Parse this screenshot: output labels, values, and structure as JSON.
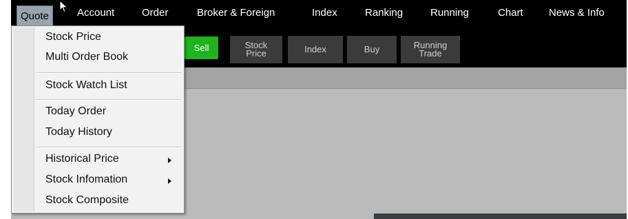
{
  "menubar": {
    "items": [
      "Quote",
      "Account",
      "Order",
      "Broker & Foreign",
      "Index",
      "Ranking",
      "Running",
      "Chart",
      "News & Info"
    ]
  },
  "toolbar": {
    "buttons": [
      {
        "label": "Sell",
        "color": "#1fb31f"
      },
      {
        "label": "Stock Price"
      },
      {
        "label": "Index"
      },
      {
        "label": "Buy"
      },
      {
        "label": "Running Trade"
      }
    ]
  },
  "quote_menu": {
    "items": [
      "Stock Price",
      "Multi Order Book",
      "Stock Watch List",
      "Today Order",
      "Today History",
      "Historical Price",
      "Stock Infomation",
      "Stock Composite"
    ],
    "submenu_indicator_icon": "triangle-right-icon"
  },
  "colors": {
    "sell_button": "#1fb31f",
    "menubar_bg": "#000000",
    "active_menu_bg": "#9aa3ad"
  }
}
